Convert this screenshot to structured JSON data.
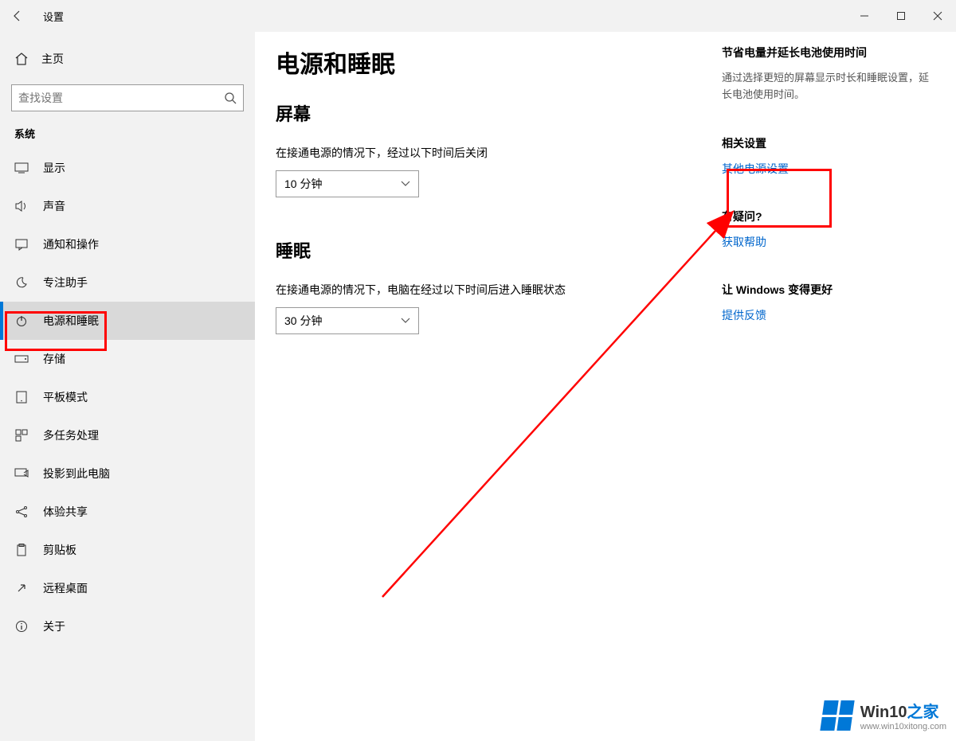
{
  "titlebar": {
    "title": "设置"
  },
  "sidebar": {
    "home": "主页",
    "search_placeholder": "查找设置",
    "section": "系统",
    "items": [
      {
        "label": "显示"
      },
      {
        "label": "声音"
      },
      {
        "label": "通知和操作"
      },
      {
        "label": "专注助手"
      },
      {
        "label": "电源和睡眠"
      },
      {
        "label": "存储"
      },
      {
        "label": "平板模式"
      },
      {
        "label": "多任务处理"
      },
      {
        "label": "投影到此电脑"
      },
      {
        "label": "体验共享"
      },
      {
        "label": "剪贴板"
      },
      {
        "label": "远程桌面"
      },
      {
        "label": "关于"
      }
    ]
  },
  "main": {
    "heading": "电源和睡眠",
    "screen_heading": "屏幕",
    "screen_label": "在接通电源的情况下，经过以下时间后关闭",
    "screen_value": "10 分钟",
    "sleep_heading": "睡眠",
    "sleep_label": "在接通电源的情况下，电脑在经过以下时间后进入睡眠状态",
    "sleep_value": "30 分钟"
  },
  "aside": {
    "tip_title": "节省电量并延长电池使用时间",
    "tip_text": "通过选择更短的屏幕显示时长和睡眠设置，延长电池使用时间。",
    "related_title": "相关设置",
    "related_link": "其他电源设置",
    "question_title": "有疑问?",
    "question_link": "获取帮助",
    "feedback_title": "让 Windows 变得更好",
    "feedback_link": "提供反馈"
  },
  "watermark": {
    "brand_prefix": "Win10",
    "brand_suffix": "之家",
    "url": "www.win10xitong.com"
  }
}
